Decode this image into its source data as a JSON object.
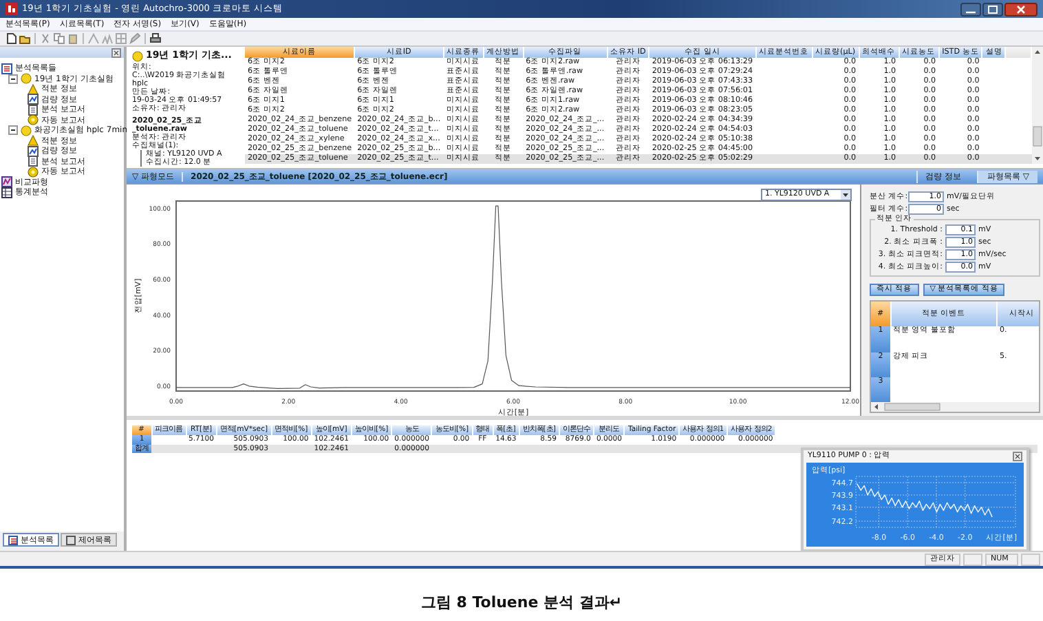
{
  "window": {
    "title": "19년 1학기 기초실험 - 영린 Autochro-3000 크로마토 시스템"
  },
  "menu": [
    "분석목록(P)",
    "시료목록(T)",
    "전자 서명(S)",
    "보기(V)",
    "도움말(H)"
  ],
  "tree": [
    {
      "label": "분석목록들",
      "kind": "list",
      "children": [
        {
          "label": "19년 1학기 기초실험",
          "kind": "folder",
          "expanded": true,
          "children": [
            {
              "label": "적분 정보",
              "kind": "integration"
            },
            {
              "label": "검량 정보",
              "kind": "calibration"
            },
            {
              "label": "분석 보고서",
              "kind": "report"
            },
            {
              "label": "자동 보고서",
              "kind": "autoreport"
            }
          ]
        },
        {
          "label": "화공기초실험 hplc 7min",
          "kind": "folder",
          "expanded": true,
          "children": [
            {
              "label": "적분 정보",
              "kind": "integration"
            },
            {
              "label": "검량 정보",
              "kind": "calibration"
            },
            {
              "label": "분석 보고서",
              "kind": "report"
            },
            {
              "label": "자동 보고서",
              "kind": "autoreport"
            }
          ]
        }
      ]
    },
    {
      "label": "비교파형",
      "kind": "compare"
    },
    {
      "label": "통계분석",
      "kind": "stats"
    }
  ],
  "left_tabs": [
    {
      "label": "분석목록",
      "selected": true
    },
    {
      "label": "제어목록",
      "selected": false
    }
  ],
  "sample_info": [
    {
      "kind": "title",
      "text": "19년 1학기 기초..."
    },
    {
      "kind": "plain",
      "text": "위치:"
    },
    {
      "kind": "plain",
      "text": "C:..\\W2019 화공기초실험 hplc"
    },
    {
      "kind": "plain",
      "text": "만든 날짜:"
    },
    {
      "kind": "plain",
      "text": "19-03-24 오후 01:49:57"
    },
    {
      "kind": "plain",
      "text": "소유자: 관리자"
    },
    {
      "kind": "bold",
      "text": "2020_02_25_조교"
    },
    {
      "kind": "bold",
      "text": "_toluene.raw"
    },
    {
      "kind": "plain",
      "text": "분석자: 관리자"
    },
    {
      "kind": "plain",
      "text": "수집채널(1):"
    },
    {
      "kind": "branch",
      "text": "채널: YL9120 UVD A"
    },
    {
      "kind": "branch",
      "text": "수집시간: 12.0 분"
    }
  ],
  "sample_table": {
    "columns": [
      {
        "label": "시료이름",
        "sorted": true
      },
      {
        "label": "시료ID",
        "sorted": false
      },
      {
        "label": "시료종류",
        "sorted": false
      },
      {
        "label": "계산방법",
        "sorted": false
      },
      {
        "label": "수집파일",
        "sorted": false
      },
      {
        "label": "소유자 ID",
        "sorted": false
      },
      {
        "label": "수집 일시",
        "sorted": false
      },
      {
        "label": "시료분석번호",
        "sorted": false
      },
      {
        "label": "시료량(μL)",
        "sorted": false
      },
      {
        "label": "희석배수",
        "sorted": false
      },
      {
        "label": "시료농도",
        "sorted": false
      },
      {
        "label": "ISTD 농도",
        "sorted": false
      },
      {
        "label": "설명",
        "sorted": false
      }
    ],
    "rows": [
      {
        "selected": false,
        "cells": [
          "6조 미지2",
          "6조 미지2",
          "미지시료",
          "적분",
          "6조 미지2.raw",
          "관리자",
          "2019-06-03 오후 06:13:29",
          null,
          "0.0",
          "1.0",
          "0.0",
          "0.0",
          null
        ]
      },
      {
        "selected": false,
        "cells": [
          "6조 톨루엔",
          "6조 톨루엔",
          "표준시료",
          "적분",
          "6조 톨루엔.raw",
          "관리자",
          "2019-06-03 오후 07:29:24",
          null,
          "0.0",
          "1.0",
          "0.0",
          "0.0",
          null
        ]
      },
      {
        "selected": false,
        "cells": [
          "6조 벤젠",
          "6조 벤젠",
          "표준시료",
          "적분",
          "6조 벤젠.raw",
          "관리자",
          "2019-06-03 오후 07:43:33",
          null,
          "0.0",
          "1.0",
          "0.0",
          "0.0",
          null
        ]
      },
      {
        "selected": false,
        "cells": [
          "6조 자일렌",
          "6조 자일렌",
          "표준시료",
          "적분",
          "6조 자일렌.raw",
          "관리자",
          "2019-06-03 오후 07:56:01",
          null,
          "0.0",
          "1.0",
          "0.0",
          "0.0",
          null
        ]
      },
      {
        "selected": false,
        "cells": [
          "6조 미지1",
          "6조 미지1",
          "미지시료",
          "적분",
          "6조 미지1.raw",
          "관리자",
          "2019-06-03 오후 08:10:46",
          null,
          "0.0",
          "1.0",
          "0.0",
          "0.0",
          null
        ]
      },
      {
        "selected": false,
        "cells": [
          "6조 미지2",
          "6조 미지2",
          "미지시료",
          "적분",
          "6조 미지2.raw",
          "관리자",
          "2019-06-03 오후 08:23:05",
          null,
          "0.0",
          "1.0",
          "0.0",
          "0.0",
          null
        ]
      },
      {
        "selected": false,
        "cells": [
          "2020_02_24_조교_benzene",
          "2020_02_24_조교_b...",
          "미지시료",
          "적분",
          "2020_02_24_조교_...",
          "관리자",
          "2020-02-24 오후 04:34:39",
          null,
          "0.0",
          "1.0",
          "0.0",
          "0.0",
          null
        ]
      },
      {
        "selected": false,
        "cells": [
          "2020_02_24_조교_toluene",
          "2020_02_24_조교_t...",
          "미지시료",
          "적분",
          "2020_02_24_조교_...",
          "관리자",
          "2020-02-24 오후 04:54:03",
          null,
          "0.0",
          "1.0",
          "0.0",
          "0.0",
          null
        ]
      },
      {
        "selected": false,
        "cells": [
          "2020_02_24_조교_xylene",
          "2020_02_24_조교_x...",
          "미지시료",
          "적분",
          "2020_02_24_조교_...",
          "관리자",
          "2020-02-24 오후 05:10:38",
          null,
          "0.0",
          "1.0",
          "0.0",
          "0.0",
          null
        ]
      },
      {
        "selected": false,
        "cells": [
          "2020_02_25_조교_benzene",
          "2020_02_25_조교_b...",
          "미지시료",
          "적분",
          "2020_02_25_조교_...",
          "관리자",
          "2020-02-25 오후 04:45:00",
          null,
          "0.0",
          "1.0",
          "0.0",
          "0.0",
          null
        ]
      },
      {
        "selected": true,
        "cells": [
          "2020_02_25_조교_toluene",
          "2020_02_25_조교_t...",
          "미지시료",
          "적분",
          "2020_02_25_조교_...",
          "관리자",
          "2020-02-25 오후 05:02:29",
          null,
          "0.0",
          "1.0",
          "0.0",
          "0.0",
          null
        ]
      }
    ]
  },
  "waveform_bar": {
    "mode": "▽ 파형모드",
    "file": "2020_02_25_조교_toluene [2020_02_25_조교_toluene.ecr]",
    "tabs": [
      {
        "label": "검량 정보",
        "selected": false
      },
      {
        "label": "파형목록 ▽",
        "selected": true
      }
    ]
  },
  "chart": {
    "channel": "1. YL9120 UVD A",
    "chart_data": {
      "type": "line",
      "xlabel": "시간[분]",
      "ylabel": "전압[mV]",
      "xlim": [
        0,
        12
      ],
      "ylim": [
        -2,
        105
      ],
      "xticks": [
        {
          "value": 0,
          "label": "0.00"
        },
        {
          "value": 2,
          "label": "2.00"
        },
        {
          "value": 4,
          "label": "4.00"
        },
        {
          "value": 6,
          "label": "6.00"
        },
        {
          "value": 8,
          "label": "8.00"
        },
        {
          "value": 10,
          "label": "10.00"
        },
        {
          "value": 12,
          "label": "12.00"
        }
      ],
      "yticks": [
        {
          "value": 0,
          "label": "0.00"
        },
        {
          "value": 20,
          "label": "20.00"
        },
        {
          "value": 40,
          "label": "40.00"
        },
        {
          "value": 60,
          "label": "60.00"
        },
        {
          "value": 80,
          "label": "80.00"
        },
        {
          "value": 100,
          "label": "100.00"
        }
      ],
      "x": [
        0,
        0.5,
        1,
        1.1,
        1.2,
        1.3,
        1.45,
        1.8,
        2.2,
        2.3,
        2.4,
        2.55,
        3,
        3.5,
        4,
        4.5,
        5,
        5.3,
        5.45,
        5.55,
        5.63,
        5.69,
        5.73,
        5.79,
        5.87,
        5.97,
        6.1,
        6.4,
        7,
        8,
        9,
        10,
        11,
        12
      ],
      "series": [
        {
          "color": "#555555",
          "values": [
            0,
            0,
            0,
            0.8,
            2,
            0.8,
            0.2,
            -0.6,
            -0.4,
            1.6,
            0.3,
            -0.3,
            0,
            0,
            0,
            0,
            0,
            0.1,
            2,
            15,
            60,
            102.2,
            102.2,
            60,
            18,
            4,
            1,
            0.3,
            0,
            0,
            0,
            0,
            0,
            0
          ]
        }
      ]
    }
  },
  "integration_panel": {
    "fields": [
      {
        "label": "분산 계수:",
        "value": "1.0",
        "unit": "mV/필요단위"
      },
      {
        "label": "필터 계수:",
        "value": "0",
        "unit": "sec"
      }
    ],
    "group_title": "적분 인자",
    "group_fields": [
      {
        "label": "1. Threshold      :",
        "value": "0.1",
        "unit": "mV"
      },
      {
        "label": "2. 최소 피크폭   :",
        "value": "1.0",
        "unit": "sec"
      },
      {
        "label": "3. 최소 피크면적:",
        "value": "1.0",
        "unit": "mV/sec"
      },
      {
        "label": "4. 최소 피크높이:",
        "value": "0.0",
        "unit": "mV"
      }
    ],
    "buttons": [
      "즉시 적용",
      "▽ 분석목록에 적용"
    ],
    "events": {
      "columns": [
        "#",
        "적분 이벤트",
        "시작시"
      ],
      "rows": [
        [
          "1",
          "적분 영역 불포함",
          "0."
        ],
        [
          "2",
          "강제 피크",
          "5."
        ],
        [
          "3",
          null,
          null
        ]
      ]
    }
  },
  "results_table": {
    "columns": [
      "#",
      "피크이름",
      "RT[분]",
      "면적[mV*sec]",
      "면적비[%]",
      "높이[mV]",
      "높이비[%]",
      "농도",
      "농도비[%]",
      "형태",
      "폭[초]",
      "반치폭[초]",
      "이론단수",
      "분리도",
      "Tailing Factor",
      "사용자 정의1",
      "사용자 정의2"
    ],
    "rows": [
      {
        "kind": "peak",
        "cells": [
          "1",
          null,
          "5.7100",
          "505.0903",
          "100.00",
          "102.2461",
          "100.00",
          "0.000000",
          "0.00",
          "FF",
          "14.63",
          "8.59",
          "8769.0",
          "0.0000",
          "1.0190",
          "0.000000",
          "0.000000"
        ]
      },
      {
        "kind": "total",
        "cells": [
          "합계",
          null,
          null,
          "505.0903",
          null,
          "102.2461",
          null,
          "0.000000",
          null,
          null,
          null,
          null,
          null,
          null,
          null,
          null,
          null
        ]
      }
    ]
  },
  "pump_window": {
    "title": "YL9110 PUMP 0 : 압력",
    "chart_data": {
      "type": "line",
      "grid": true,
      "xlabel": "시간[분]",
      "ylabel": "압력[psi]",
      "xlim": [
        -9.6,
        1.5
      ],
      "ylim": [
        741.8,
        745.1
      ],
      "xticks": [
        {
          "value": -8,
          "label": "-8.0"
        },
        {
          "value": -6,
          "label": "-6.0"
        },
        {
          "value": -4,
          "label": "-4.0"
        },
        {
          "value": -2,
          "label": "-2.0"
        }
      ],
      "yticks": [
        {
          "value": 744.7,
          "label": "744.7"
        },
        {
          "value": 743.9,
          "label": "743.9"
        },
        {
          "value": 743.1,
          "label": "743.1"
        },
        {
          "value": 742.2,
          "label": "742.2"
        }
      ],
      "x": [
        -9.5,
        -9.26,
        -9.02,
        -8.78,
        -8.54,
        -8.3,
        -8.06,
        -7.82,
        -7.58,
        -7.34,
        -7.1,
        -6.86,
        -6.62,
        -6.38,
        -6.14,
        -5.9,
        -5.66,
        -5.42,
        -5.18,
        -4.94,
        -4.7,
        -4.46,
        -4.22,
        -3.98,
        -3.74,
        -3.5,
        -3.26,
        -3.02,
        -2.78,
        -2.54,
        -2.3,
        -2.06,
        -1.82,
        -1.58,
        -1.34,
        -1.1,
        -0.86,
        -0.62,
        -0.38,
        -0.14
      ],
      "series": [
        {
          "color": "#f4f8ff",
          "values": [
            744.6,
            744.2,
            744.5,
            743.9,
            744.3,
            743.8,
            744.1,
            743.6,
            743.9,
            743.3,
            743.7,
            743.2,
            743.6,
            743.1,
            743.5,
            743.0,
            743.4,
            743.1,
            743.5,
            742.9,
            743.3,
            743.0,
            743.4,
            742.8,
            743.3,
            742.9,
            743.4,
            743.0,
            743.3,
            742.8,
            743.2,
            742.9,
            743.3,
            742.7,
            743.2,
            742.8,
            743.1,
            742.6,
            743.0,
            742.5
          ]
        }
      ]
    }
  },
  "status_bar": [
    "관리자",
    "NUM"
  ],
  "caption": "그림 8 Toluene 분석 결과↵"
}
